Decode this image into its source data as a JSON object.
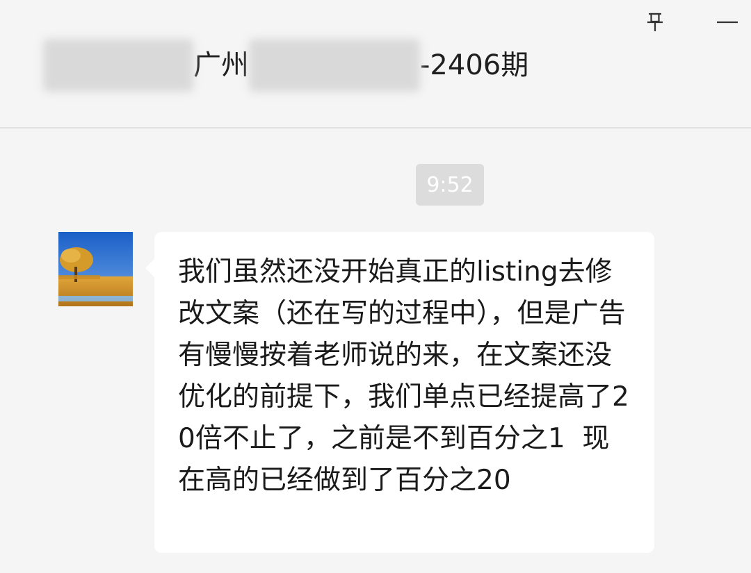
{
  "header": {
    "title_part1": "广州",
    "title_part2": "-2406期",
    "pin_icon": "pin-icon",
    "minimize_icon": "minimize-icon"
  },
  "chat": {
    "timestamp": "9:52",
    "messages": [
      {
        "avatar_icon": "avatar-landscape-image",
        "text": "我们虽然还没开始真正的listing去修改文案（还在写的过程中），但是广告有慢慢按着老师说的来，在文案还没优化的前提下，我们单点已经提高了20倍不止了，之前是不到百分之1  现在高的已经做到了百分之20"
      }
    ]
  },
  "colors": {
    "background": "#f5f5f5",
    "bubble": "#ffffff",
    "timestamp_badge": "#dcdcdc"
  }
}
